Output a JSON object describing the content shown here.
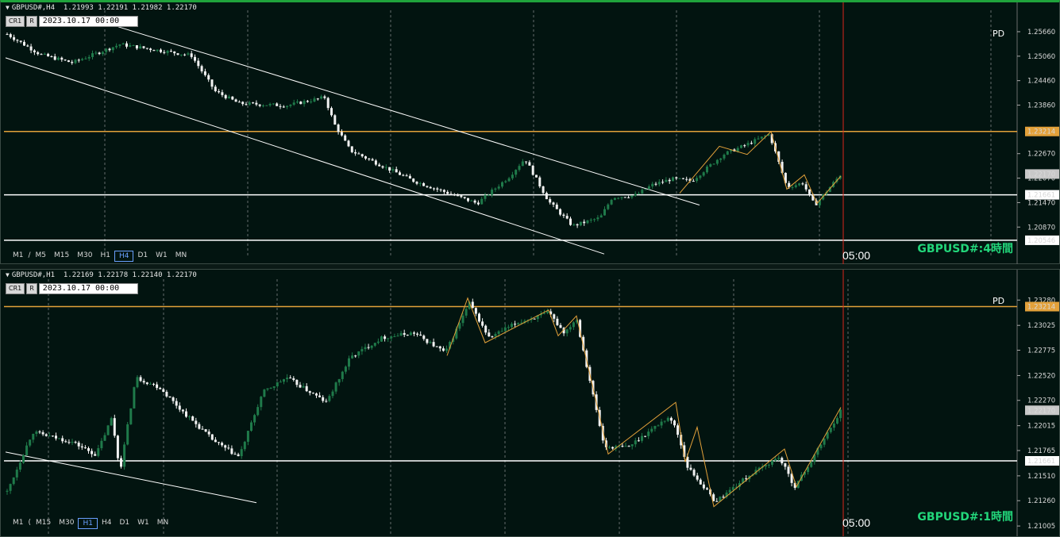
{
  "colors": {
    "bull": "#1f7a4a",
    "bear": "#f2f2f2",
    "orange": "#e3a13a",
    "redline": "#d9261c",
    "support": "#ffffff"
  },
  "h4": {
    "symbol_line": "GBPUSD#,H4",
    "ohlc": "1.21993 1.22191 1.21982 1.22170",
    "date": "2023.10.17 00:00",
    "buttons": [
      "CR1",
      "R"
    ],
    "timeframes": [
      "M1",
      "/",
      "M5",
      "M15",
      "M30",
      "H1",
      "H4",
      "D1",
      "W1",
      "MN"
    ],
    "active_tf": "H4",
    "pair_label": "GBPUSD#:4時間",
    "time_label": "05:00",
    "pd_label": "PD",
    "price_labels": [
      "1.25660",
      "1.25060",
      "1.24460",
      "1.23860",
      "1.22670",
      "1.22070",
      "1.21470",
      "1.20870"
    ],
    "level_orange": "1.23214",
    "level_current": "1.22170",
    "level_support": "1.21661",
    "level_low": "1.20546",
    "y_range": [
      1.2035,
      1.2599
    ]
  },
  "h1": {
    "symbol_line": "GBPUSD#,H1",
    "ohlc": "1.22169 1.22178 1.22140 1.22170",
    "date": "2023.10.17 00:00",
    "buttons": [
      "CR1",
      "R"
    ],
    "timeframes": [
      "M1",
      "(",
      "M15",
      "M30",
      "H1",
      "H4",
      "D1",
      "W1",
      "MN"
    ],
    "active_tf": "H1",
    "pair_label": "GBPUSD#:1時間",
    "time_label": "05:00",
    "pd_label": "PD",
    "price_labels": [
      "1.23280",
      "1.23025",
      "1.22775",
      "1.22520",
      "1.22270",
      "1.22015",
      "1.21765",
      "1.21510",
      "1.21260",
      "1.21005"
    ],
    "level_orange": "1.23214",
    "level_current": "1.22170",
    "level_support": "1.21661",
    "y_range": [
      1.2099,
      1.2341
    ]
  }
}
